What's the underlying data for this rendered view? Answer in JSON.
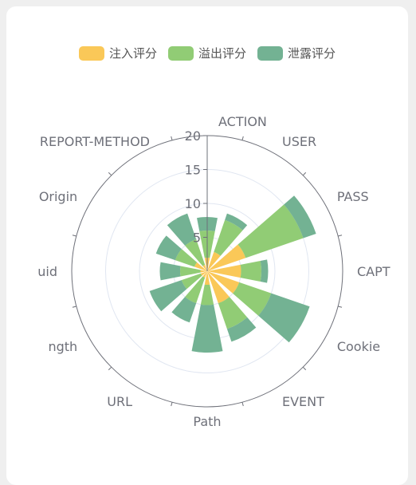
{
  "chart_data": {
    "type": "polar-stacked-bar",
    "categories": [
      "ACTION",
      "USER",
      "PASS",
      "CAPT",
      "Cookie",
      "EVENT",
      "Path",
      "URL",
      "ngth",
      "uid",
      "Origin",
      "REPORT-METHOD"
    ],
    "series": [
      {
        "name": "注入评分",
        "color": "#fac858",
        "values": [
          2,
          3,
          6,
          5,
          5,
          5,
          2,
          1,
          1,
          1,
          2,
          1
        ]
      },
      {
        "name": "溢出评分",
        "color": "#91cc75",
        "values": [
          4,
          5,
          9,
          3,
          5,
          4,
          3,
          4,
          3,
          3,
          3,
          4
        ]
      },
      {
        "name": "泄露评分",
        "color": "#73b293",
        "values": [
          2,
          1,
          2,
          1,
          6,
          2,
          7,
          3,
          5,
          3,
          3,
          4
        ]
      }
    ],
    "rlim": [
      0,
      20
    ],
    "r_ticks": [
      "5",
      "10",
      "15",
      "20"
    ],
    "legend_position": "top"
  }
}
